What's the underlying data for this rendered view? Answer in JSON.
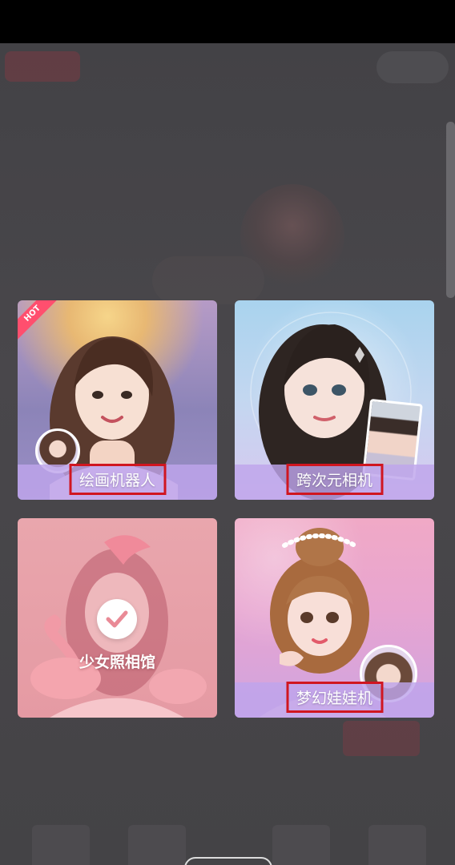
{
  "colors": {
    "overlay": "#3b3b3f",
    "label_band": "#bea5eb",
    "highlight_border": "#d01620",
    "hot_ribbon": "#ff4f6e"
  },
  "cards": [
    {
      "label": "绘画机器人",
      "badge": "HOT",
      "icon": "portrait-illustration"
    },
    {
      "label": "跨次元相机",
      "icon": "anime-portrait"
    },
    {
      "label": "少女照相馆",
      "icon": "check-icon"
    },
    {
      "label": "梦幻娃娃机",
      "icon": "doll-portrait"
    }
  ]
}
